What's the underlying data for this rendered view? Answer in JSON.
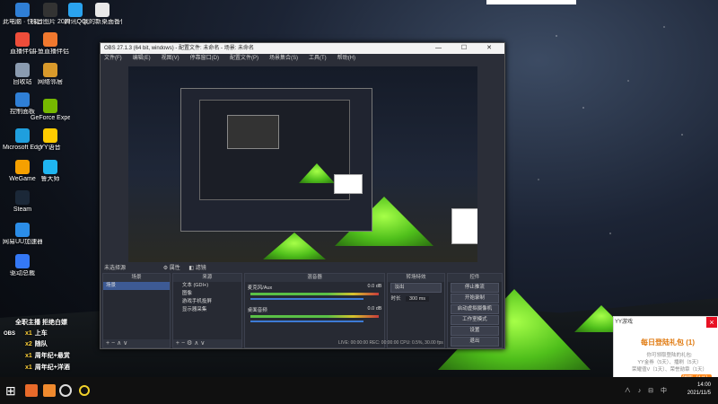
{
  "desktop_icons": [
    {
      "label": "此电脑 · 快捷方式",
      "color": "#2f7fd6"
    },
    {
      "label": "抖音图片 20210...",
      "color": "#333333"
    },
    {
      "label": "腾讯QQ",
      "color": "#2aa3ef"
    },
    {
      "label": "我的新桌面备份",
      "color": "#e8e8e8"
    },
    {
      "label": "直播伴侣",
      "color": "#ee4d3a"
    },
    {
      "label": "斗鱼直播伴侣",
      "color": "#f0782e"
    },
    {
      "label": "回收站",
      "color": "#8a9bb0"
    },
    {
      "label": "网络邻居",
      "color": "#d99a2b"
    },
    {
      "label": "控制面板",
      "color": "#2f7fd6"
    },
    {
      "label": "GeForce Experience",
      "color": "#76b900"
    },
    {
      "label": "Microsoft Edge",
      "color": "#1f9fde"
    },
    {
      "label": "YY语音",
      "color": "#ffcc00"
    },
    {
      "label": "WeGame",
      "color": "#f5a000"
    },
    {
      "label": "鲁大师",
      "color": "#1fb5f0"
    },
    {
      "label": "Steam",
      "color": "#1b2838"
    },
    {
      "label": "网易UU加速器",
      "color": "#2b8de8"
    },
    {
      "label": "驱动总裁",
      "color": "#3478f6"
    }
  ],
  "obs": {
    "title": "OBS 27.1.3 (64 bit, windows) - 配置文件: 未命名 - 场景: 未命名",
    "menu": [
      "文件(F)",
      "编辑(E)",
      "视图(V)",
      "停靠窗口(D)",
      "配置文件(P)",
      "场景集合(S)",
      "工具(T)",
      "帮助(H)"
    ],
    "status_label": "未选择源",
    "status_buttons": [
      "属性",
      "滤镜"
    ],
    "docks": {
      "scenes": {
        "title": "场景",
        "items": [
          "场景"
        ]
      },
      "sources": {
        "title": "来源",
        "items": [
          "文本 (GDI+)",
          "图像",
          "游戏手机投屏",
          "显示器采集"
        ]
      },
      "mixer": {
        "title": "混音器",
        "channels": [
          {
            "name": "麦克风/Aux",
            "db": "0.0 dB"
          },
          {
            "name": "桌面音频",
            "db": "0.0 dB"
          }
        ]
      },
      "transitions": {
        "title": "转场特效",
        "type": "淡出",
        "duration_label": "时长",
        "duration": "300 ms"
      },
      "controls": {
        "title": "控件",
        "buttons": [
          "停止推流",
          "开始录制",
          "启动虚拟摄像机",
          "工作室模式",
          "设置",
          "退出"
        ]
      }
    },
    "stats": "LIVE: 00:00:00   REC: 00:00:00   CPU: 0.5%, 30.00 fps"
  },
  "overlay": {
    "title_line": "全职主播  拒绝白嫖",
    "rows": [
      {
        "num": "x1",
        "label": "上车"
      },
      {
        "num": "x2",
        "label": "随队"
      },
      {
        "num": "x1",
        "label": "周年纪+悬赏"
      },
      {
        "num": "x1",
        "label": "周年纪+洋酒"
      }
    ],
    "corner_label": "OBS"
  },
  "notification": {
    "app": "YY游戏",
    "title": "每日登陆礼包 (1)",
    "body": "你可领取登陆的礼包:\nYY金券（5天）、播刷（5天）\n荣耀值V（1天）、荣誉勋章（1天）",
    "button": "领取（1/1）"
  },
  "taskbar": {
    "time": "14:00",
    "date": "2021/11/5",
    "tray_icons": "∧ ♪ ⊟ 中"
  },
  "colors": {
    "obs_bg": "#2b2e38",
    "accent": "#3d5a94",
    "tent": "#5fce22",
    "notif_orange": "#ff8a1e"
  }
}
